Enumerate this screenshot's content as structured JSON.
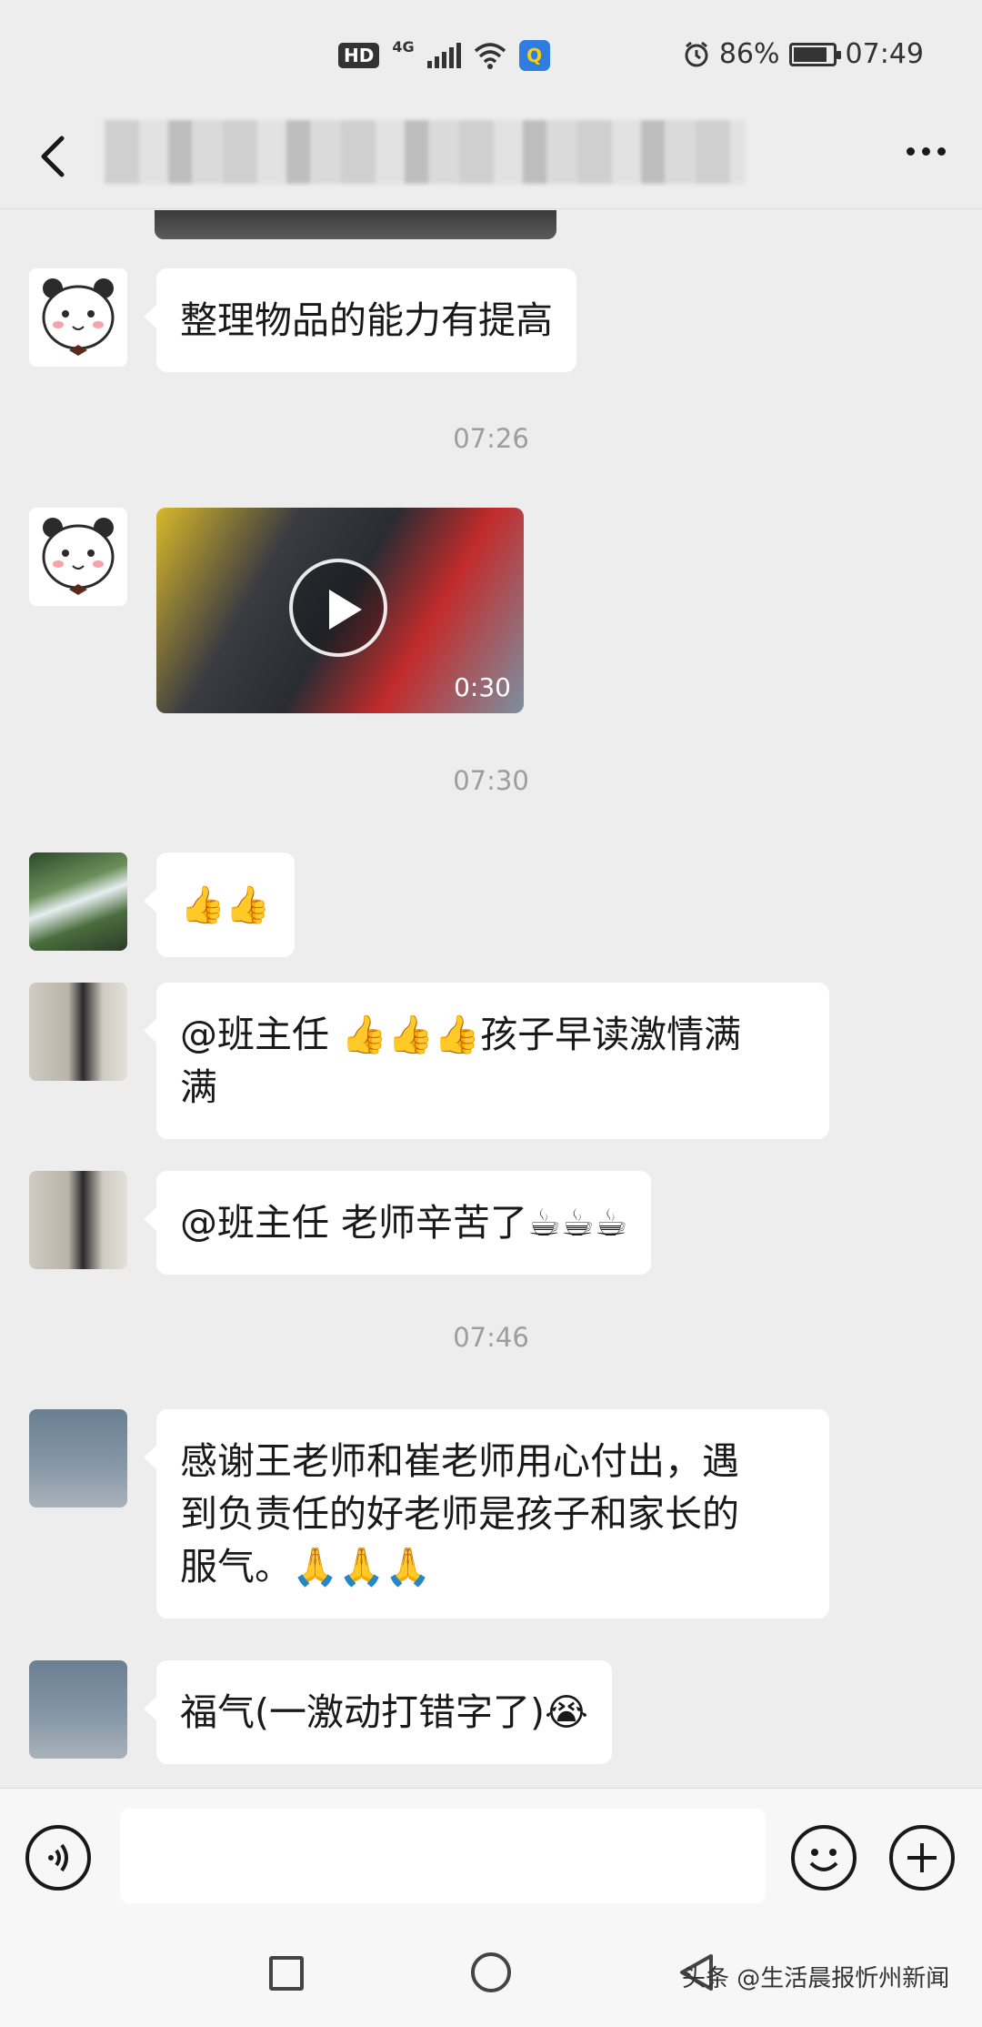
{
  "status_bar": {
    "hd": "HD",
    "network": "4G",
    "battery_percent": "86%",
    "time": "07:49",
    "battery_level": 0.86
  },
  "header": {
    "title": "",
    "back_icon": "chevron-left-icon",
    "more_icon": "more-dots-icon"
  },
  "messages": [
    {
      "type": "text",
      "sender": "panda",
      "text": "整理物品的能力有提高"
    },
    {
      "type": "time",
      "text": "07:26"
    },
    {
      "type": "video",
      "sender": "panda",
      "duration": "0:30"
    },
    {
      "type": "time",
      "text": "07:30"
    },
    {
      "type": "emoji",
      "sender": "waterfall",
      "emojis": [
        "👍",
        "👍"
      ]
    },
    {
      "type": "text",
      "sender": "couple",
      "text_line1": "@班主任  👍👍👍孩子早读激情满",
      "text_line2": "满"
    },
    {
      "type": "text",
      "sender": "couple",
      "text": "@班主任  老师辛苦了☕☕☕"
    },
    {
      "type": "time",
      "text": "07:46"
    },
    {
      "type": "text",
      "sender": "chair",
      "text_line1": "感谢王老师和崔老师用心付出，遇",
      "text_line2": "到负责任的好老师是孩子和家长的",
      "text_line3": "服气。🙏🙏🙏"
    },
    {
      "type": "text",
      "sender": "chair",
      "text": "福气(一激动打错字了)😭"
    }
  ],
  "input_bar": {
    "voice_icon": "voice-icon",
    "emoji_icon": "smiley-icon",
    "plus_icon": "plus-icon"
  },
  "nav": {
    "watermark": "头条 @生活晨报忻州新闻"
  }
}
